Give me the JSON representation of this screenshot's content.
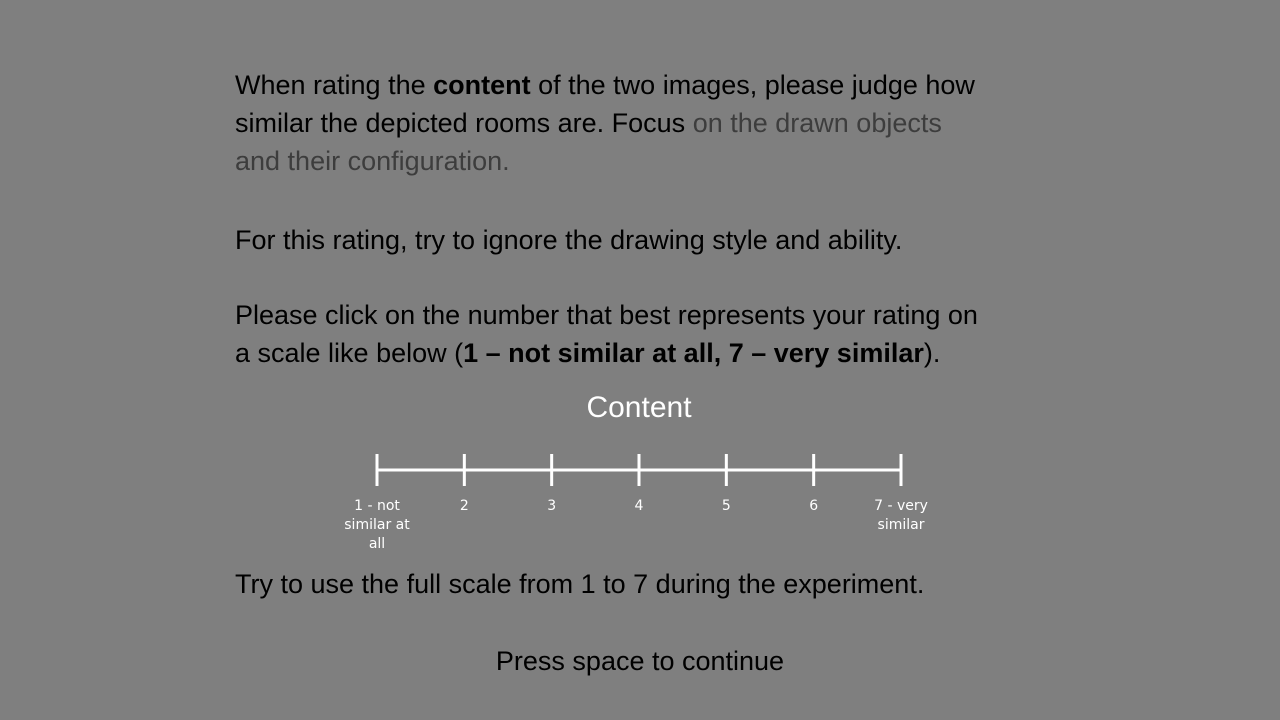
{
  "instructions": {
    "p1": {
      "part1": "When rating the ",
      "bold": "content",
      "part2": " of the two images, please judge how",
      "line2_dark": "similar the depicted rooms are. Focus",
      "line2_faded": " on the drawn objects",
      "line3_faded": "and their configuration."
    },
    "p2": "For this rating, try to ignore the drawing style and ability.",
    "p3": {
      "line1": "Please click on the number that best represents your rating on",
      "line2_before": "a scale like below  (",
      "line2_bold": "1 – not similar at all, 7 – very similar",
      "line2_after": ")."
    },
    "p4": "Try to use the full scale from 1 to 7 during the experiment."
  },
  "scale": {
    "title": "Content",
    "ticks": [
      {
        "line1": "1 - not",
        "line2": "similar at",
        "line3": "all"
      },
      {
        "line1": "2"
      },
      {
        "line1": "3"
      },
      {
        "line1": "4"
      },
      {
        "line1": "5"
      },
      {
        "line1": "6"
      },
      {
        "line1": "7 - very",
        "line2": "similar"
      }
    ]
  },
  "continue_prompt": "Press space to continue"
}
